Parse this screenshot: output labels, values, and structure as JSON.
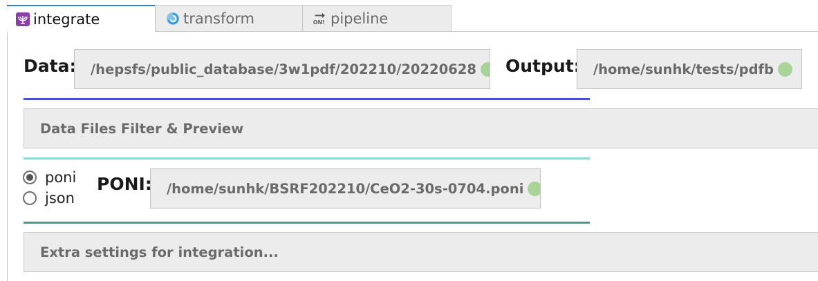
{
  "tabs": [
    {
      "label": "integrate",
      "icon": "menorah-icon",
      "active": true
    },
    {
      "label": "transform",
      "icon": "swirl-icon",
      "active": false
    },
    {
      "label": "pipeline",
      "icon": "on-switch-icon",
      "active": false
    }
  ],
  "data_field": {
    "label": "Data:",
    "path": "/hepsfs/public_database/3w1pdf/202210/20220628",
    "status_color": "#a8d49a"
  },
  "output_field": {
    "label": "Output:",
    "path": "/home/sunhk/tests/pdfb",
    "status_color": "#a8d49a"
  },
  "sections": {
    "filter_preview": "Data Files Filter & Preview",
    "extra_settings": "Extra settings for integration..."
  },
  "calibration": {
    "options": [
      {
        "label": "poni",
        "selected": true
      },
      {
        "label": "json",
        "selected": false
      }
    ],
    "label": "PONI:",
    "path": "/home/sunhk/BSRF202210/CeO2-30s-0704.poni",
    "status_color": "#a8d49a"
  },
  "colors": {
    "tab_accent": "#2f7ed8",
    "separator_1": "#4a4fd6",
    "separator_2": "#8fd8cf",
    "separator_3": "#4b9b8a"
  }
}
